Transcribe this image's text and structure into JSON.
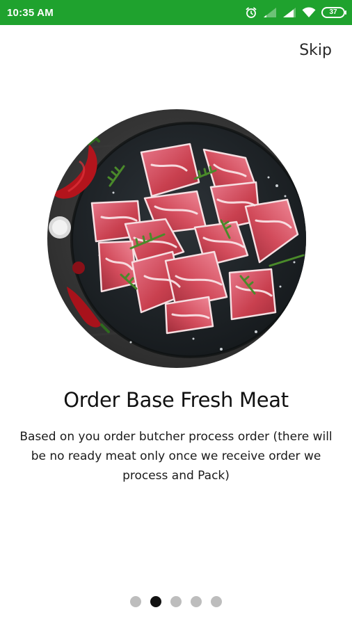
{
  "status_bar": {
    "time": "10:35 AM",
    "battery_level": "37",
    "background_color": "#1fa22e"
  },
  "header": {
    "skip_label": "Skip"
  },
  "onboarding": {
    "title": "Order Base Fresh Meat",
    "description": "Based on you order butcher process order (there will be no ready meat only once we receive order we process and Pack)"
  },
  "pager": {
    "total_pages": 5,
    "active_page": 2,
    "active_color": "#111111",
    "inactive_color": "#bdbdbd"
  }
}
